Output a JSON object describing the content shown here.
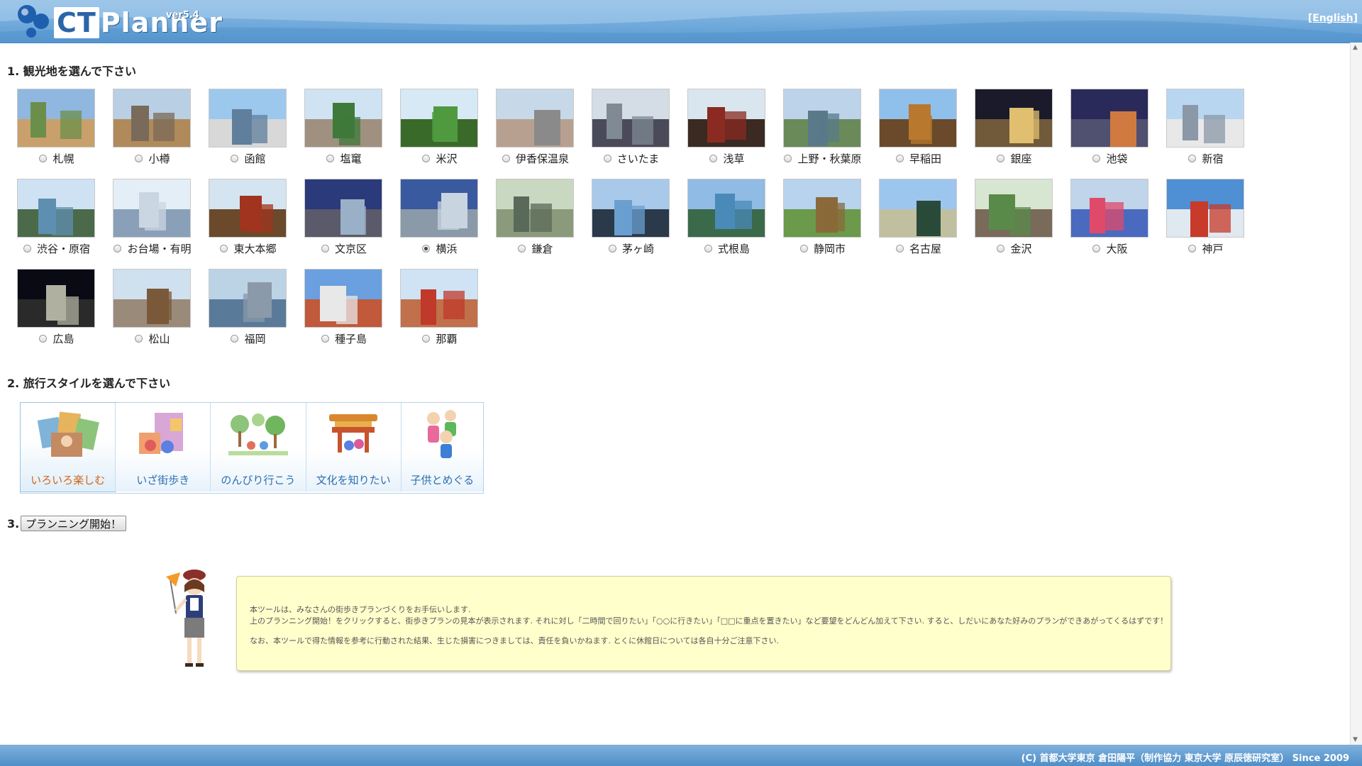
{
  "header": {
    "logo_ct": "CT",
    "logo_planner": "Planner",
    "version": "ver5.4",
    "language_link": "[English]"
  },
  "section1": {
    "title": "1. 観光地を選んで下さい"
  },
  "destinations": [
    {
      "label": "札幌",
      "selected": false
    },
    {
      "label": "小樽",
      "selected": false
    },
    {
      "label": "函館",
      "selected": false
    },
    {
      "label": "塩竃",
      "selected": false
    },
    {
      "label": "米沢",
      "selected": false
    },
    {
      "label": "伊香保温泉",
      "selected": false
    },
    {
      "label": "さいたま",
      "selected": false
    },
    {
      "label": "浅草",
      "selected": false
    },
    {
      "label": "上野・秋葉原",
      "selected": false
    },
    {
      "label": "早稲田",
      "selected": false
    },
    {
      "label": "銀座",
      "selected": false
    },
    {
      "label": "池袋",
      "selected": false
    },
    {
      "label": "新宿",
      "selected": false
    },
    {
      "label": "渋谷・原宿",
      "selected": false
    },
    {
      "label": "お台場・有明",
      "selected": false
    },
    {
      "label": "東大本郷",
      "selected": false
    },
    {
      "label": "文京区",
      "selected": false
    },
    {
      "label": "横浜",
      "selected": true
    },
    {
      "label": "鎌倉",
      "selected": false
    },
    {
      "label": "茅ヶ崎",
      "selected": false
    },
    {
      "label": "式根島",
      "selected": false
    },
    {
      "label": "静岡市",
      "selected": false
    },
    {
      "label": "名古屋",
      "selected": false
    },
    {
      "label": "金沢",
      "selected": false
    },
    {
      "label": "大阪",
      "selected": false
    },
    {
      "label": "神戸",
      "selected": false
    },
    {
      "label": "広島",
      "selected": false
    },
    {
      "label": "松山",
      "selected": false
    },
    {
      "label": "福岡",
      "selected": false
    },
    {
      "label": "種子島",
      "selected": false
    },
    {
      "label": "那覇",
      "selected": false
    }
  ],
  "section2": {
    "title": "2. 旅行スタイルを選んで下さい"
  },
  "styles": [
    {
      "label": "いろいろ楽しむ",
      "active": true
    },
    {
      "label": "いざ街歩き",
      "active": false
    },
    {
      "label": "のんびり行こう",
      "active": false
    },
    {
      "label": "文化を知りたい",
      "active": false
    },
    {
      "label": "子供とめぐる",
      "active": false
    }
  ],
  "section3": {
    "number": "3.",
    "button": "プランニング開始！"
  },
  "info": {
    "line1": "本ツールは、みなさんの街歩きプランづくりをお手伝いします.",
    "line2": "上のプランニング開始！をクリックすると、街歩きプランの見本が表示されます. それに対し「二時間で回りたい」「○○に行きたい」「□□に重点を置きたい」など要望をどんどん加えて下さい. すると、しだいにあなた好みのプランができあがってくるはずです！",
    "line3": "なお、本ツールで得た情報を参考に行動された結果、生じた損害につきましては、責任を負いかねます. とくに休館日については各自十分ご注意下さい."
  },
  "footer": {
    "text": "(C) 首都大学東京 倉田陽平（制作協力 東京大学 原辰徳研究室） Since 2009"
  },
  "colors": {
    "header": "#5a9bd4",
    "footer": "#4f8ec8",
    "info_bg": "#ffffcc",
    "style_label": "#2b6fb0",
    "style_active": "#d2641a"
  }
}
